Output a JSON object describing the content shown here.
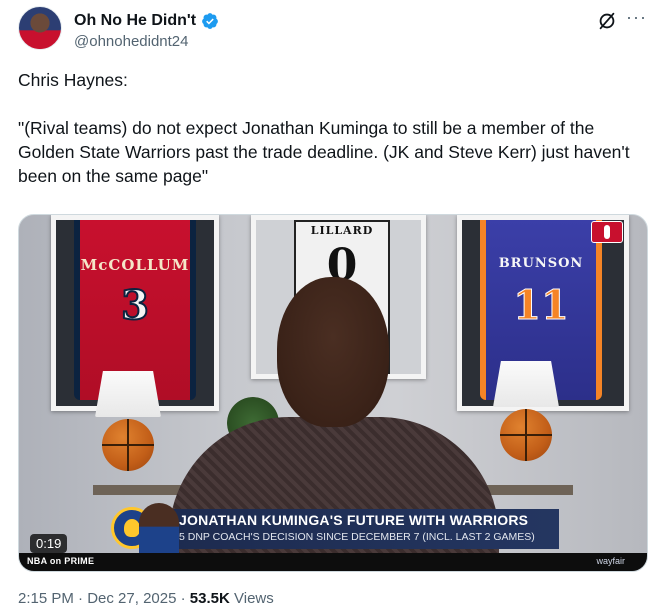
{
  "author": {
    "display_name": "Oh No He Didn't",
    "handle": "@ohnohedidnt24",
    "verified": true,
    "verified_color": "#1d9bf0"
  },
  "header_icons": [
    "grok-icon",
    "more-options-icon"
  ],
  "tweet": {
    "line1": "Chris Haynes:",
    "line2": "\"(Rival teams) do not expect Jonathan Kuminga to still be a member of the Golden State Warriors past the trade deadline. (JK and Steve Kerr) just haven't been on the same page\""
  },
  "media": {
    "type": "video",
    "duration": "0:19",
    "jerseys": [
      {
        "name": "McCOLLUM",
        "number": "3"
      },
      {
        "name": "LILLARD",
        "number": "0"
      },
      {
        "name": "BRUNSON",
        "number": "11"
      }
    ],
    "chyron_title": "JONATHAN KUMINGA'S FUTURE WITH WARRIORS",
    "chyron_sub": "5 DNP COACH'S DECISION SINCE DECEMBER 7 (INCL. LAST 2 GAMES)",
    "network_label": "NBA on PRIME",
    "sponsor_label": "wayfair"
  },
  "meta": {
    "time": "2:15 PM",
    "separator": "·",
    "date": "Dec 27, 2025",
    "views_count": "53.5K",
    "views_label": "Views"
  }
}
